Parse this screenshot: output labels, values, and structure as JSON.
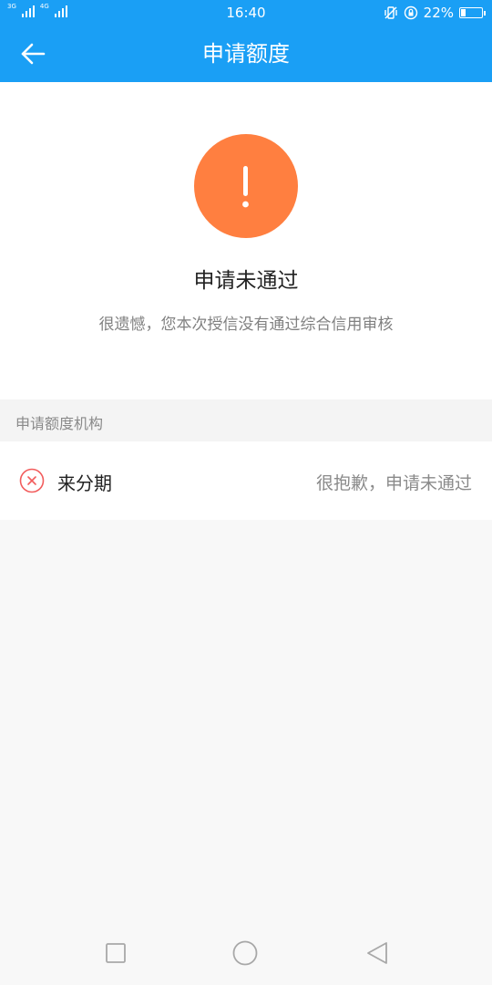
{
  "status_bar": {
    "network_1": "3G",
    "network_2": "4G",
    "time": "16:40",
    "battery_text": "22%",
    "battery_level": 0.22
  },
  "nav": {
    "title": "申请额度",
    "back_icon": "arrow-left-icon"
  },
  "result": {
    "icon": "exclamation-icon",
    "icon_color": "#ff7f40",
    "title": "申请未通过",
    "description": "很遗憾，您本次授信没有通过综合信用审核"
  },
  "section": {
    "header": "申请额度机构"
  },
  "institutions": [
    {
      "icon": "fail-circle-icon",
      "name": "来分期",
      "status": "很抱歉，申请未通过"
    }
  ],
  "colors": {
    "primary": "#1a9ff5",
    "alert": "#ff7f40",
    "fail": "#f25c5c"
  },
  "system_nav": {
    "recents_icon": "square-icon",
    "home_icon": "circle-icon",
    "back_icon": "triangle-back-icon"
  }
}
